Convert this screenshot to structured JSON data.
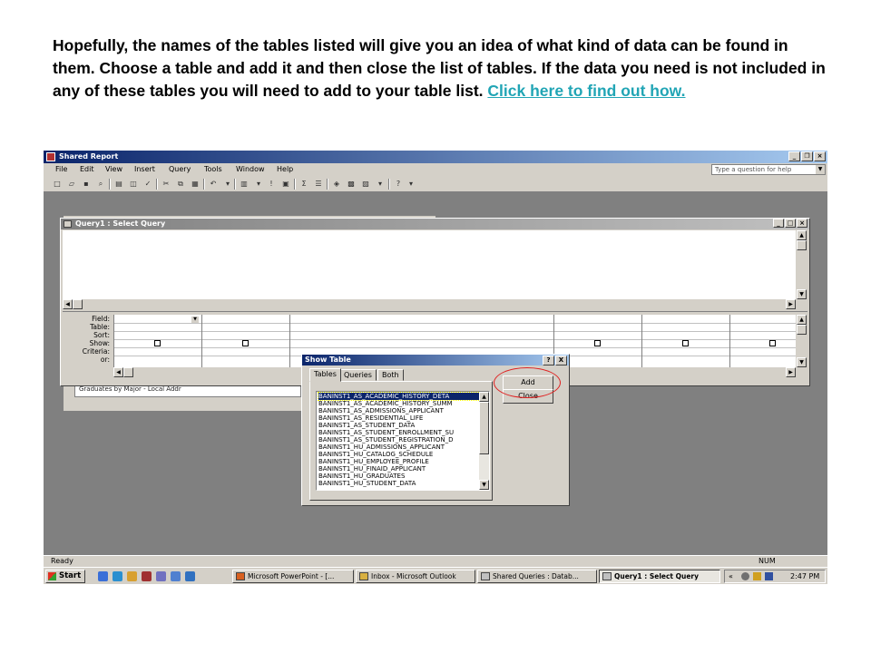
{
  "caption": {
    "text": "Hopefully, the names of the tables listed will give you an idea of what kind of data can be found in them.  Choose a table and add it and then close the list of tables. If the data you need is not included in any of these tables you will need to add to your table list.",
    "link": "Click here to find out how."
  },
  "app": {
    "title": "Shared Report",
    "menu": [
      "File",
      "Edit",
      "View",
      "Insert",
      "Query",
      "Tools",
      "Window",
      "Help"
    ],
    "help_placeholder": "Type a question for help",
    "background_list_item": "Graduates by Major - Local Addr"
  },
  "query_window": {
    "title": "Query1 : Select Query",
    "row_labels": [
      "Field:",
      "Table:",
      "Sort:",
      "Show:",
      "Criteria:",
      "or:"
    ]
  },
  "dialog": {
    "title": "Show Table",
    "help_btn": "?",
    "close_btn": "X",
    "tabs": [
      "Tables",
      "Queries",
      "Both"
    ],
    "active_tab": "Tables",
    "tables": [
      "BANINST1_AS_ACADEMIC_HISTORY_DETA",
      "BANINST1_AS_ACADEMIC_HISTORY_SUMM",
      "BANINST1_AS_ADMISSIONS_APPLICANT",
      "BANINST1_AS_RESIDENTIAL_LIFE",
      "BANINST1_AS_STUDENT_DATA",
      "BANINST1_AS_STUDENT_ENROLLMENT_SU",
      "BANINST1_AS_STUDENT_REGISTRATION_D",
      "BANINST1_HU_ADMISSIONS_APPLICANT",
      "BANINST1_HU_CATALOG_SCHEDULE",
      "BANINST1_HU_EMPLOYEE_PROFILE",
      "BANINST1_HU_FINAID_APPLICANT",
      "BANINST1_HU_GRADUATES",
      "BANINST1_HU_STUDENT_DATA"
    ],
    "selected_table": "BANINST1_AS_ACADEMIC_HISTORY_DETA",
    "add_label": "Add",
    "close_label": "Close"
  },
  "status": {
    "left": "Ready",
    "right": "NUM"
  },
  "taskbar": {
    "start": "Start",
    "tasks": [
      {
        "label": "Microsoft PowerPoint - [...",
        "active": false
      },
      {
        "label": "Inbox - Microsoft Outlook",
        "active": false
      },
      {
        "label": "Shared Queries : Datab...",
        "active": false
      },
      {
        "label": "Query1 : Select Query",
        "active": true
      }
    ],
    "tray_chevron": "«",
    "clock": "2:47 PM"
  },
  "colors": {
    "caption_link": "#21a5b5",
    "titlebar": "#0a246a",
    "selection": "#0a246a",
    "highlight_ellipse": "#e02020"
  }
}
